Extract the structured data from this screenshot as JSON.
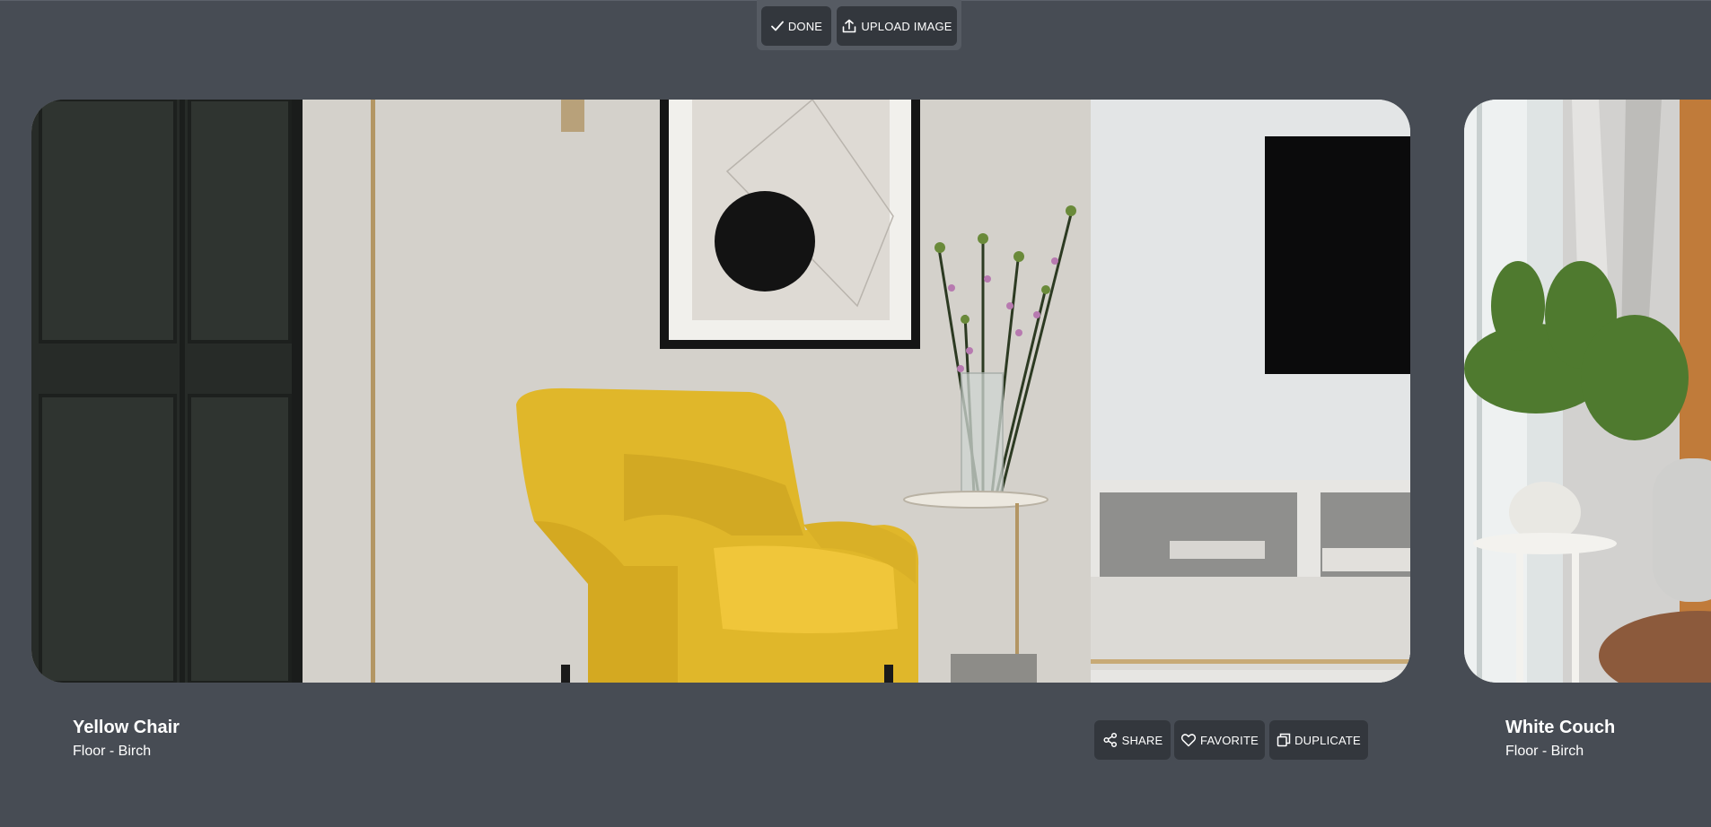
{
  "toolbar": {
    "done_label": "DONE",
    "upload_label": "UPLOAD IMAGE"
  },
  "cards": [
    {
      "title": "Yellow Chair",
      "subtitle": "Floor - Birch",
      "actions": {
        "share_label": "SHARE",
        "favorite_label": "FAVORITE",
        "duplicate_label": "DUPLICATE"
      }
    },
    {
      "title": "White Couch",
      "subtitle": "Floor - Birch"
    }
  ],
  "icons": {
    "done": "check-icon",
    "upload": "upload-icon",
    "share": "share-icon",
    "favorite": "heart-icon",
    "duplicate": "duplicate-icon"
  },
  "colors": {
    "background": "#474c54",
    "button": "#33373d",
    "toolbar": "#565b63",
    "chair": "#e0b72a"
  }
}
